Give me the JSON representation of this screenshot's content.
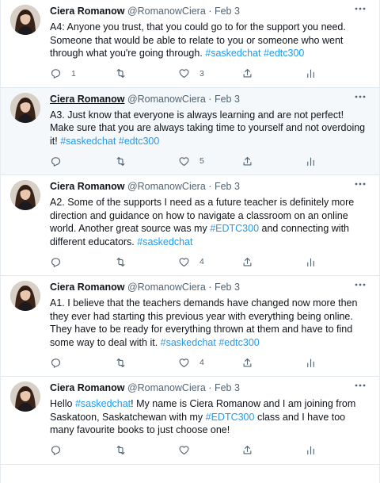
{
  "tweets": [
    {
      "author": "Ciera Romanow",
      "handle": "@RomanowCiera",
      "separator": "·",
      "date": "Feb 3",
      "text_parts": [
        {
          "t": "A4: Anyone you trust, that you could go to for the support you need. Someone that would be able to relate to you or someone who went through what you're going through. ",
          "tag": false
        },
        {
          "t": "#saskedchat",
          "tag": true
        },
        {
          "t": " ",
          "tag": false
        },
        {
          "t": "#edtc300",
          "tag": true
        }
      ],
      "reply_count": "1",
      "retweet_count": "",
      "like_count": "3",
      "hovered": false
    },
    {
      "author": "Ciera Romanow",
      "handle": "@RomanowCiera",
      "separator": "·",
      "date": "Feb 3",
      "text_parts": [
        {
          "t": "A3. Just know that everyone is always learning and are not perfect! Make sure that you are always taking time to yourself and not overdoing it! ",
          "tag": false
        },
        {
          "t": "#saskedchat",
          "tag": true
        },
        {
          "t": " ",
          "tag": false
        },
        {
          "t": "#edtc300",
          "tag": true
        }
      ],
      "reply_count": "",
      "retweet_count": "",
      "like_count": "5",
      "hovered": true
    },
    {
      "author": "Ciera Romanow",
      "handle": "@RomanowCiera",
      "separator": "·",
      "date": "Feb 3",
      "text_parts": [
        {
          "t": "A2. Some of the supports I need as a future teacher is definitely more direction and guidance on how to navigate a classroom on an online world. Another great source was my ",
          "tag": false
        },
        {
          "t": "#EDTC300",
          "tag": true
        },
        {
          "t": " and connecting with different educators. ",
          "tag": false
        },
        {
          "t": "#saskedchat",
          "tag": true
        }
      ],
      "reply_count": "",
      "retweet_count": "",
      "like_count": "4",
      "hovered": false
    },
    {
      "author": "Ciera Romanow",
      "handle": "@RomanowCiera",
      "separator": "·",
      "date": "Feb 3",
      "text_parts": [
        {
          "t": "A1. I believe that the teachers demands have changed now more then they ever had starting this previous year with everything being online. They have to be ready for everything thrown at them and have to find some way to deal with it. ",
          "tag": false
        },
        {
          "t": "#saskedchat",
          "tag": true
        },
        {
          "t": " ",
          "tag": false
        },
        {
          "t": "#edtc300",
          "tag": true
        }
      ],
      "reply_count": "",
      "retweet_count": "",
      "like_count": "4",
      "hovered": false
    },
    {
      "author": "Ciera Romanow",
      "handle": "@RomanowCiera",
      "separator": "·",
      "date": "Feb 3",
      "text_parts": [
        {
          "t": "Hello ",
          "tag": false
        },
        {
          "t": "#saskedchat",
          "tag": true
        },
        {
          "t": "! My name is Ciera Romanow and I am joining from Saskatoon, Saskatchewan with my ",
          "tag": false
        },
        {
          "t": "#EDTC300",
          "tag": true
        },
        {
          "t": " class and I have too many favourite books to just choose one!",
          "tag": false
        }
      ],
      "reply_count": "",
      "retweet_count": "",
      "like_count": "",
      "hovered": false
    }
  ],
  "icons": {
    "reply": "reply-icon",
    "retweet": "retweet-icon",
    "like": "heart-icon",
    "share": "share-icon",
    "stats": "analytics-icon",
    "more": "more-options-icon"
  },
  "colors": {
    "hashtag": "#1d9bf0",
    "muted": "#536471",
    "hover_bg": "#f5f8fa",
    "divider": "#e1e8ed"
  }
}
